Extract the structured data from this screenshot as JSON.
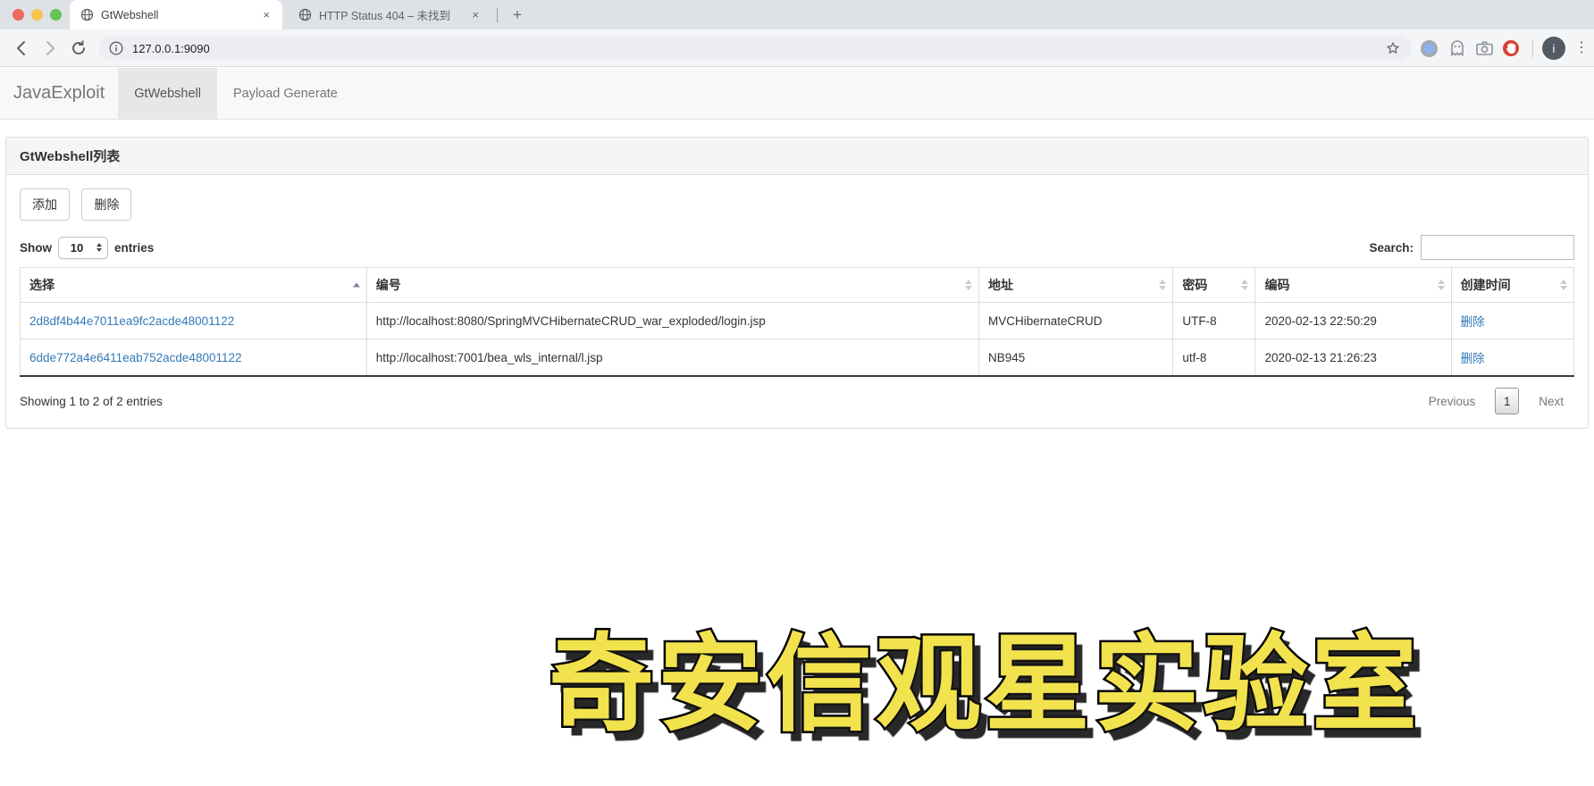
{
  "browser": {
    "tabs": [
      {
        "title": "GtWebshell"
      },
      {
        "title": "HTTP Status 404 – 未找到"
      }
    ],
    "url": "127.0.0.1:9090",
    "profile_initial": "i"
  },
  "icons": {
    "new_tab": "+",
    "close_tab": "×",
    "kebab_menu": "⋮"
  },
  "navbar": {
    "brand": "JavaExploit",
    "items": [
      {
        "label": "GtWebshell",
        "active": true
      },
      {
        "label": "Payload Generate",
        "active": false
      }
    ]
  },
  "panel": {
    "title": "GtWebshell列表",
    "add_button": "添加",
    "delete_button": "删除"
  },
  "datatable": {
    "length": {
      "show": "Show",
      "value": "10",
      "entries": "entries"
    },
    "search": {
      "label": "Search:",
      "value": ""
    },
    "columns": [
      "选择",
      "编号",
      "地址",
      "密码",
      "编码",
      "创建时间"
    ],
    "rows": [
      {
        "select": "2d8df4b44e7011ea9fc2acde48001122",
        "number": "http://localhost:8080/SpringMVCHibernateCRUD_war_exploded/login.jsp",
        "address": "MVCHibernateCRUD",
        "password": "UTF-8",
        "encoding": "2020-02-13 22:50:29",
        "action": "删除"
      },
      {
        "select": "6dde772a4e6411eab752acde48001122",
        "number": "http://localhost:7001/bea_wls_internal/l.jsp",
        "address": "NB945",
        "password": "utf-8",
        "encoding": "2020-02-13 21:26:23",
        "action": "删除"
      }
    ],
    "info": "Showing 1 to 2 of 2 entries",
    "pagination": {
      "previous": "Previous",
      "current_page": "1",
      "next": "Next"
    }
  },
  "watermark": {
    "text": "奇安信观星实验室"
  },
  "colors": {
    "link_blue": "#337ab7",
    "watermark_yellow": "#f2e24e",
    "navbar_bg": "#f8f8f8",
    "navbar_active_bg": "#e7e7e7",
    "panel_heading_bg": "#f5f5f5",
    "traffic_red": "#ee6a5f",
    "traffic_yellow": "#f5c451",
    "traffic_green": "#62c554",
    "adblock_red": "#d8402f"
  }
}
